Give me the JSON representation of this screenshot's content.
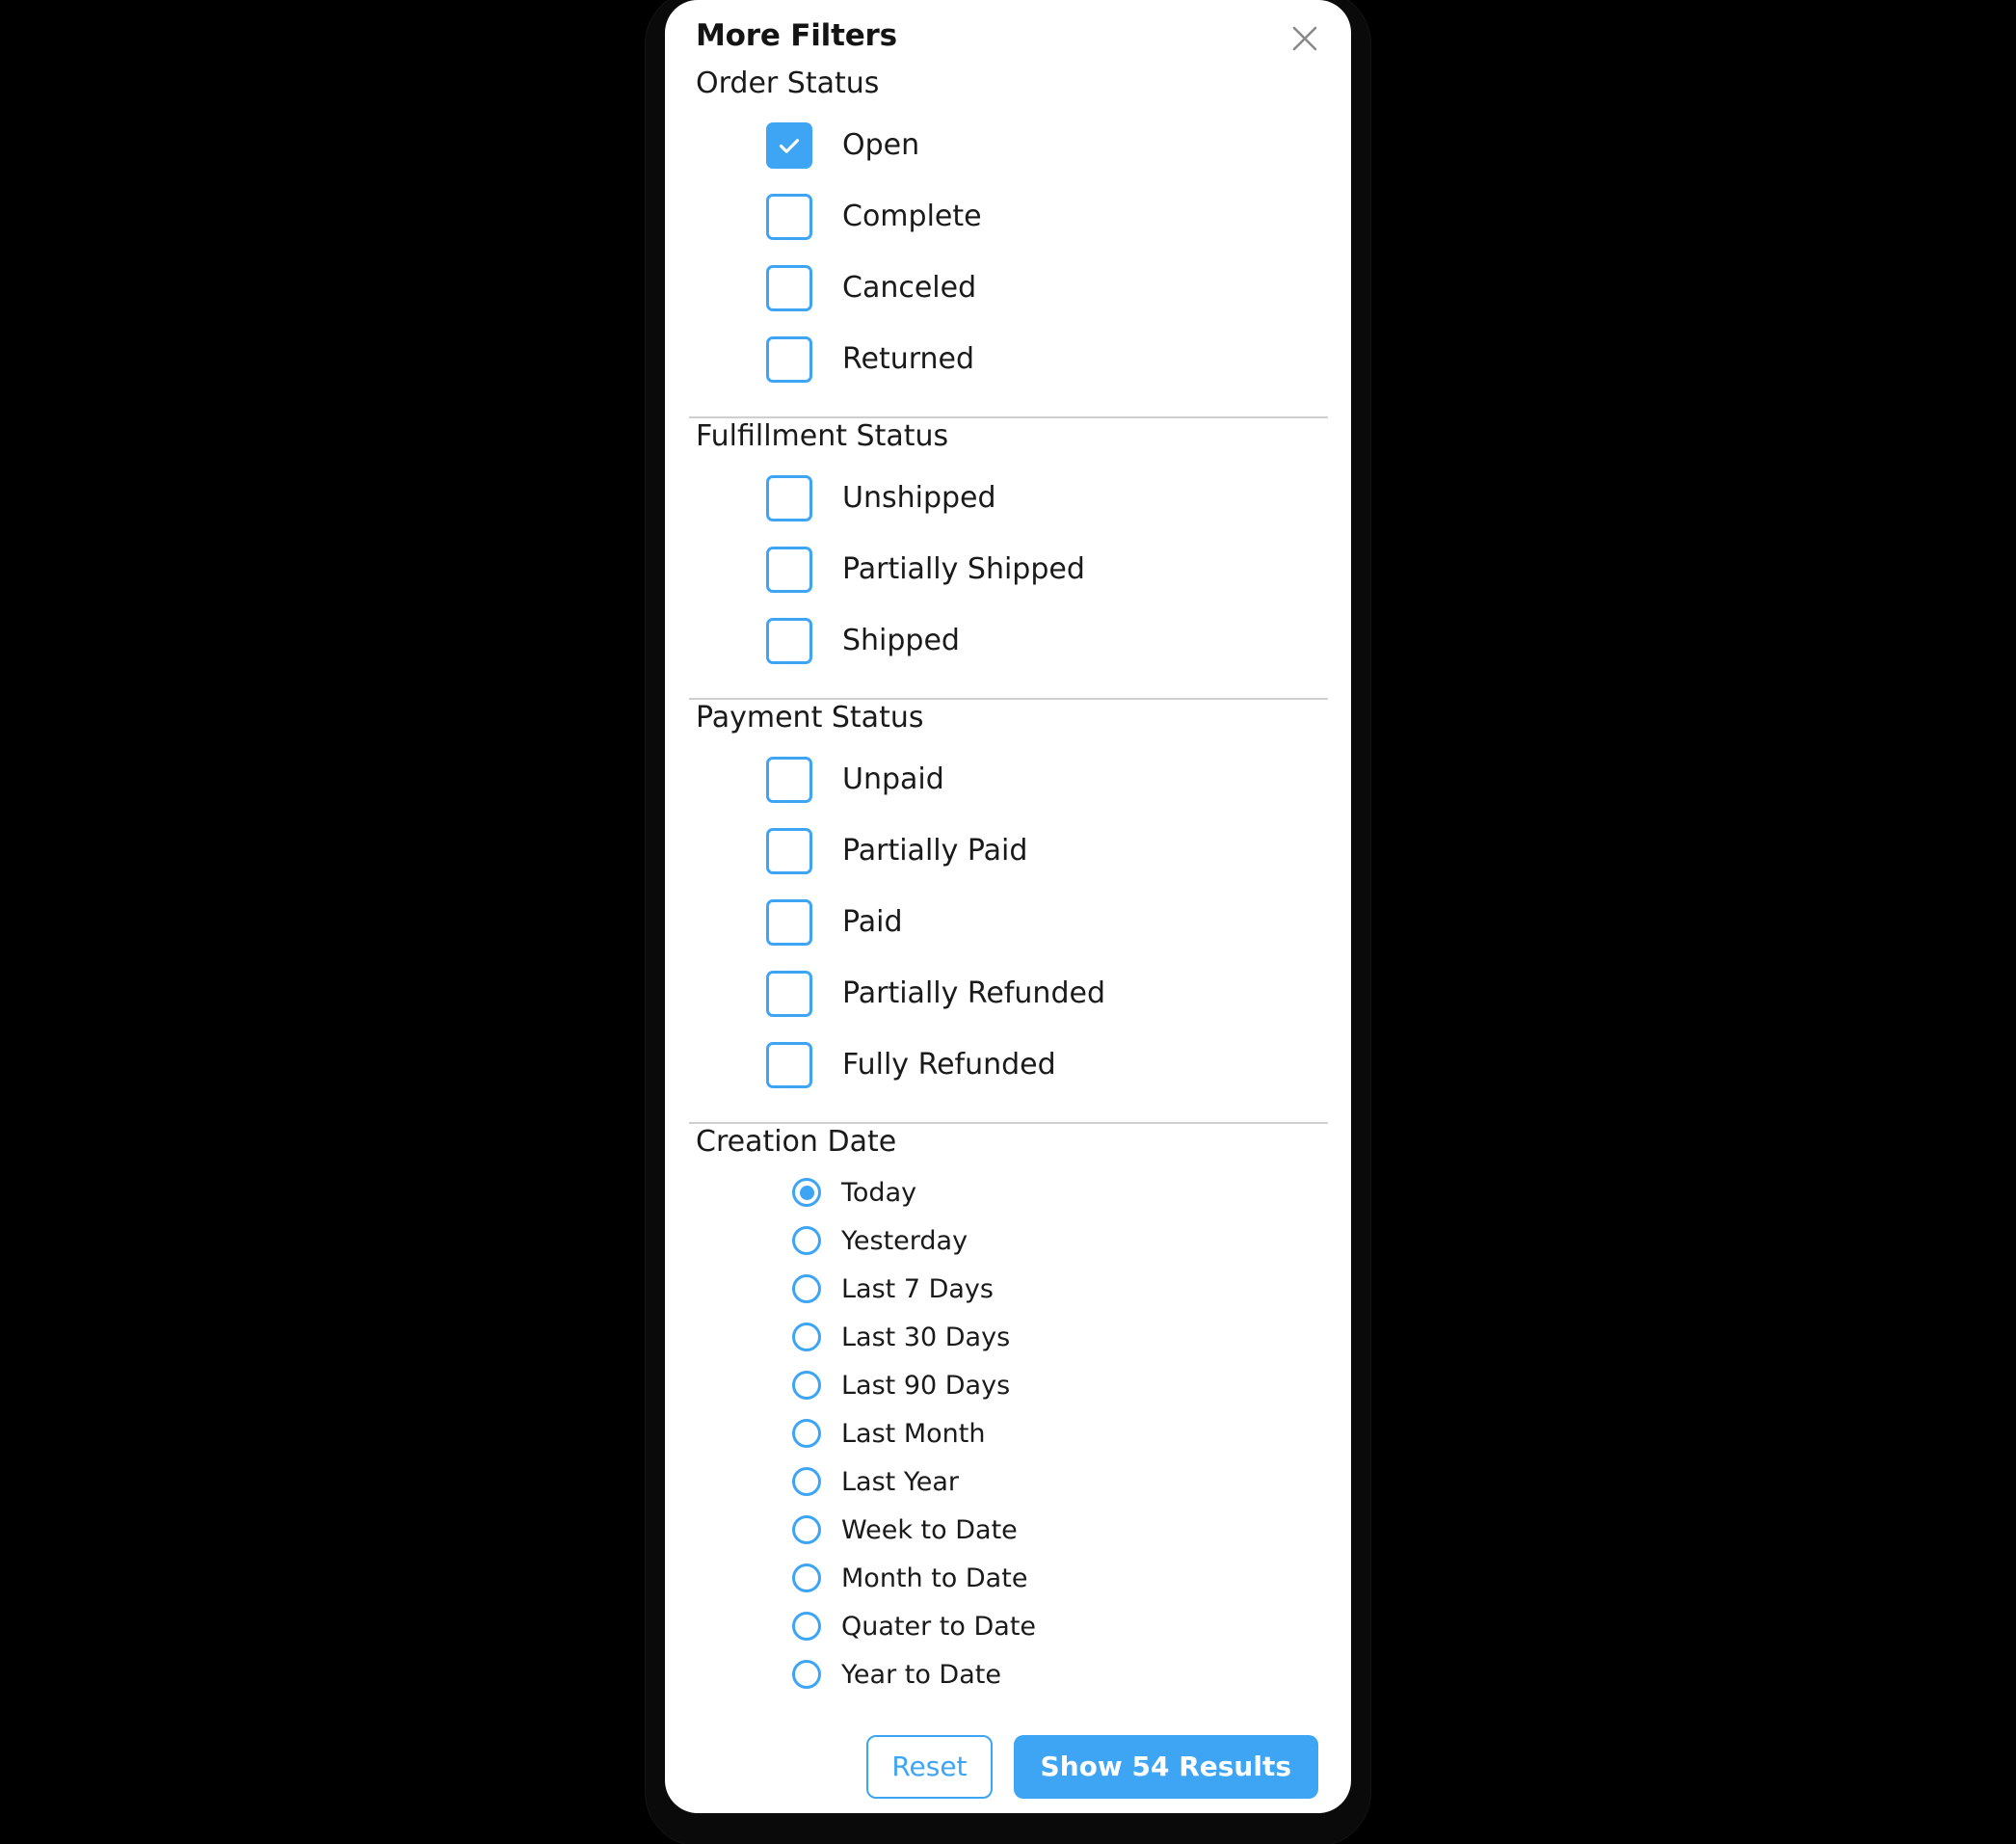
{
  "dialog": {
    "title": "More Filters",
    "close_icon": "close-icon"
  },
  "sections": [
    {
      "id": "order-status",
      "title": "Order Status",
      "control": "checkbox",
      "options": [
        {
          "label": "Open",
          "checked": true
        },
        {
          "label": "Complete",
          "checked": false
        },
        {
          "label": "Canceled",
          "checked": false
        },
        {
          "label": "Returned",
          "checked": false
        }
      ]
    },
    {
      "id": "fulfillment-status",
      "title": "Fulfillment Status",
      "control": "checkbox",
      "options": [
        {
          "label": "Unshipped",
          "checked": false
        },
        {
          "label": "Partially Shipped",
          "checked": false
        },
        {
          "label": "Shipped",
          "checked": false
        }
      ]
    },
    {
      "id": "payment-status",
      "title": "Payment Status",
      "control": "checkbox",
      "options": [
        {
          "label": "Unpaid",
          "checked": false
        },
        {
          "label": "Partially Paid",
          "checked": false
        },
        {
          "label": "Paid",
          "checked": false
        },
        {
          "label": "Partially Refunded",
          "checked": false
        },
        {
          "label": "Fully Refunded",
          "checked": false
        }
      ]
    },
    {
      "id": "creation-date",
      "title": "Creation Date",
      "control": "radio",
      "options": [
        {
          "label": "Today",
          "selected": true
        },
        {
          "label": "Yesterday",
          "selected": false
        },
        {
          "label": "Last 7 Days",
          "selected": false
        },
        {
          "label": "Last 30 Days",
          "selected": false
        },
        {
          "label": "Last 90 Days",
          "selected": false
        },
        {
          "label": "Last Month",
          "selected": false
        },
        {
          "label": "Last Year",
          "selected": false
        },
        {
          "label": "Week to Date",
          "selected": false
        },
        {
          "label": "Month to Date",
          "selected": false
        },
        {
          "label": "Quater to Date",
          "selected": false
        },
        {
          "label": "Year to Date",
          "selected": false
        }
      ]
    }
  ],
  "footer": {
    "reset_label": "Reset",
    "show_results_label": "Show 54 Results",
    "results_count": 54
  },
  "colors": {
    "accent": "#3da5f4",
    "text": "#1a1a1a",
    "divider": "#cfcfcf",
    "panel_bg": "#ffffff",
    "backdrop": "#000000"
  }
}
